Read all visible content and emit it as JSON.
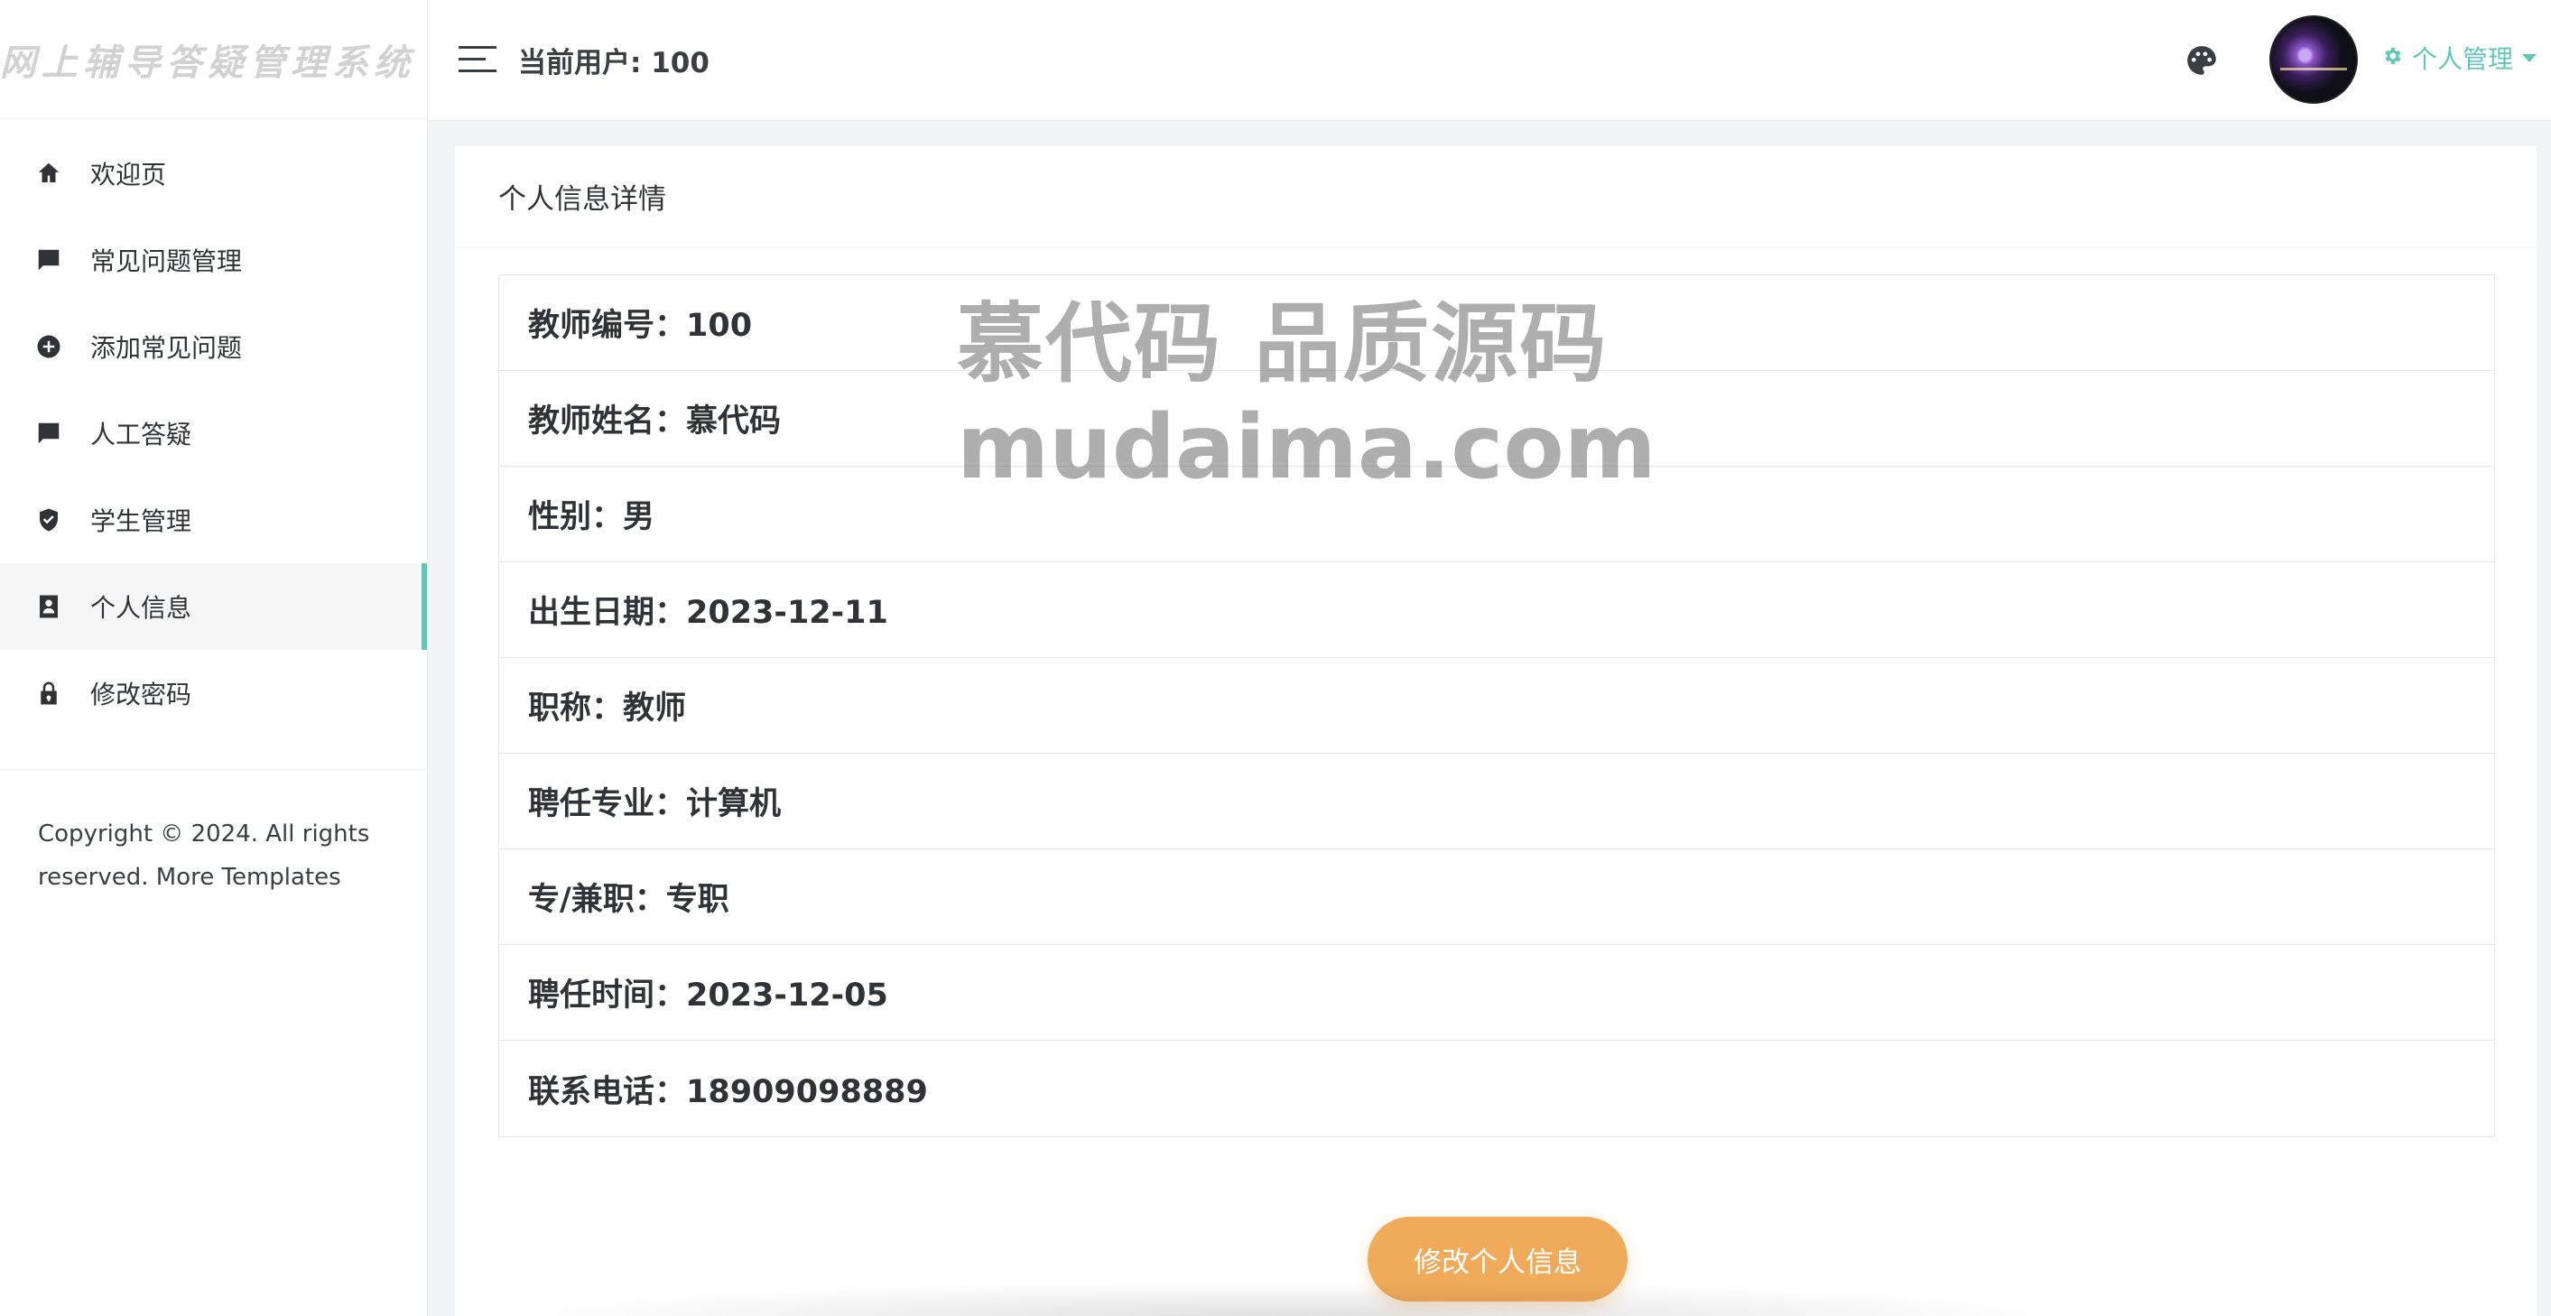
{
  "app": {
    "brand_title": "网上辅导答疑管理系统"
  },
  "sidebar": {
    "items": [
      {
        "label": "欢迎页",
        "icon": "home-icon"
      },
      {
        "label": "常见问题管理",
        "icon": "comment-icon"
      },
      {
        "label": "添加常见问题",
        "icon": "plus-circle-icon"
      },
      {
        "label": "人工答疑",
        "icon": "feedback-icon"
      },
      {
        "label": "学生管理",
        "icon": "shield-check-icon"
      },
      {
        "label": "个人信息",
        "icon": "contact-card-icon",
        "active": true
      },
      {
        "label": "修改密码",
        "icon": "lock-icon"
      }
    ],
    "copyright_line1": "Copyright © 2024. All rights",
    "copyright_line2": "reserved. More Templates"
  },
  "header": {
    "current_user": "当前用户: 100",
    "user_menu_label": "个人管理",
    "accent_color": "#5fc7b7"
  },
  "main": {
    "card_title": "个人信息详情",
    "fields": [
      "教师编号：100",
      "教师姓名：慕代码",
      "性别：男",
      "出生日期：2023-12-11",
      "职称：教师",
      "聘任专业：计算机",
      "专/兼职：专职",
      "聘任时间：2023-12-05",
      "联系电话：18909098889"
    ],
    "edit_button_label": "修改个人信息",
    "button_color": "#efaa5a"
  },
  "watermark": {
    "line1": "慕代码 品质源码",
    "line2": "mudaima.com"
  }
}
